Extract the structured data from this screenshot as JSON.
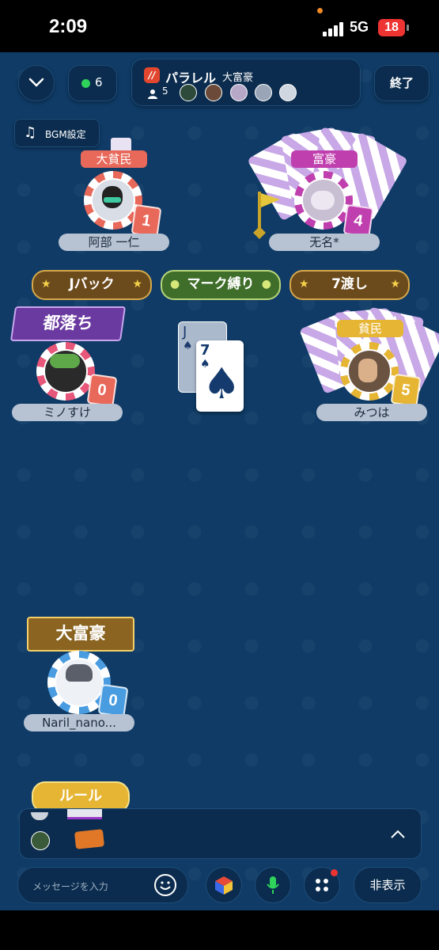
{
  "status_bar": {
    "time": "2:09",
    "network": "5G",
    "battery": "18"
  },
  "header": {
    "online_count": "6",
    "room_title": "パラレル",
    "room_game": "大富豪",
    "player_count": "5",
    "end_label": "終了",
    "logo_text": "//"
  },
  "bgm_label": "BGM設定",
  "players": {
    "top_left": {
      "name": "阿部 一仁",
      "role": "大貧民",
      "cards": "1"
    },
    "top_right": {
      "name": "无名*",
      "role": "富豪",
      "cards": "4"
    },
    "mid_left": {
      "name": "ミノすけ",
      "status": "都落ち",
      "cards": "0"
    },
    "mid_right": {
      "name": "みつは",
      "role": "貧民",
      "cards": "5"
    },
    "self": {
      "name": "Naril_nano...",
      "role": "大富豪",
      "cards": "0"
    }
  },
  "rules": {
    "r1": "Jバック",
    "r2": "マーク縛り",
    "r3": "7渡し"
  },
  "table_cards": {
    "back_rank": "J",
    "back_suit": "♠",
    "front_rank": "7",
    "front_suit": "♠"
  },
  "rule_button": "ルール",
  "chat": {
    "placeholder": "メッセージを入力",
    "hide_label": "非表示"
  },
  "colors": {
    "table": "#0f3b66",
    "panel": "#0b2c4e",
    "red_badge": "#e8685a",
    "purple_badge": "#c03fae",
    "blue_badge": "#4a9ce0",
    "gold": "#e6b533"
  }
}
